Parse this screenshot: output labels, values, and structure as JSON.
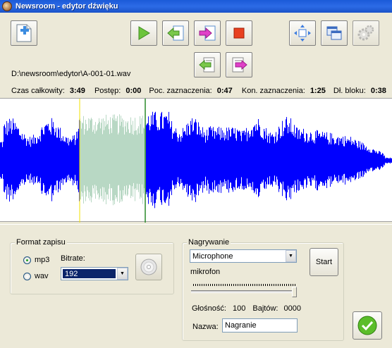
{
  "window": {
    "title": "Newsroom - edytor dźwięku"
  },
  "file": {
    "path": "D:\\newsroom\\edytor\\A-001-01.wav"
  },
  "stats": {
    "total_label": "Czas całkowity:",
    "total_value": "3:49",
    "progress_label": "Postęp:",
    "progress_value": "0:00",
    "sel_start_label": "Poc. zaznaczenia:",
    "sel_start_value": "0:47",
    "sel_end_label": "Kon. zaznaczenia:",
    "sel_end_value": "1:25",
    "block_label": "Dł. bloku:",
    "block_value": "0:38"
  },
  "colors": {
    "wave": "#0000ff",
    "selection": "#b8d8c4",
    "cursor_start": "#f0e000",
    "cursor_end": "#2a8a2a"
  },
  "format": {
    "group_label": "Format zapisu",
    "mp3_label": "mp3",
    "wav_label": "wav",
    "selected_format": "mp3",
    "bitrate_label": "Bitrate:",
    "bitrate_value": "192"
  },
  "record": {
    "group_label": "Nagrywanie",
    "device_value": "Microphone",
    "mic_label": "mikrofon",
    "volume_level": 1.0,
    "volume_label": "Głośność:",
    "volume_value": "100",
    "bytes_label": "Bajtów:",
    "bytes_value": "0000",
    "name_label": "Nazwa:",
    "name_value": "Nagranie",
    "start_label": "Start"
  }
}
